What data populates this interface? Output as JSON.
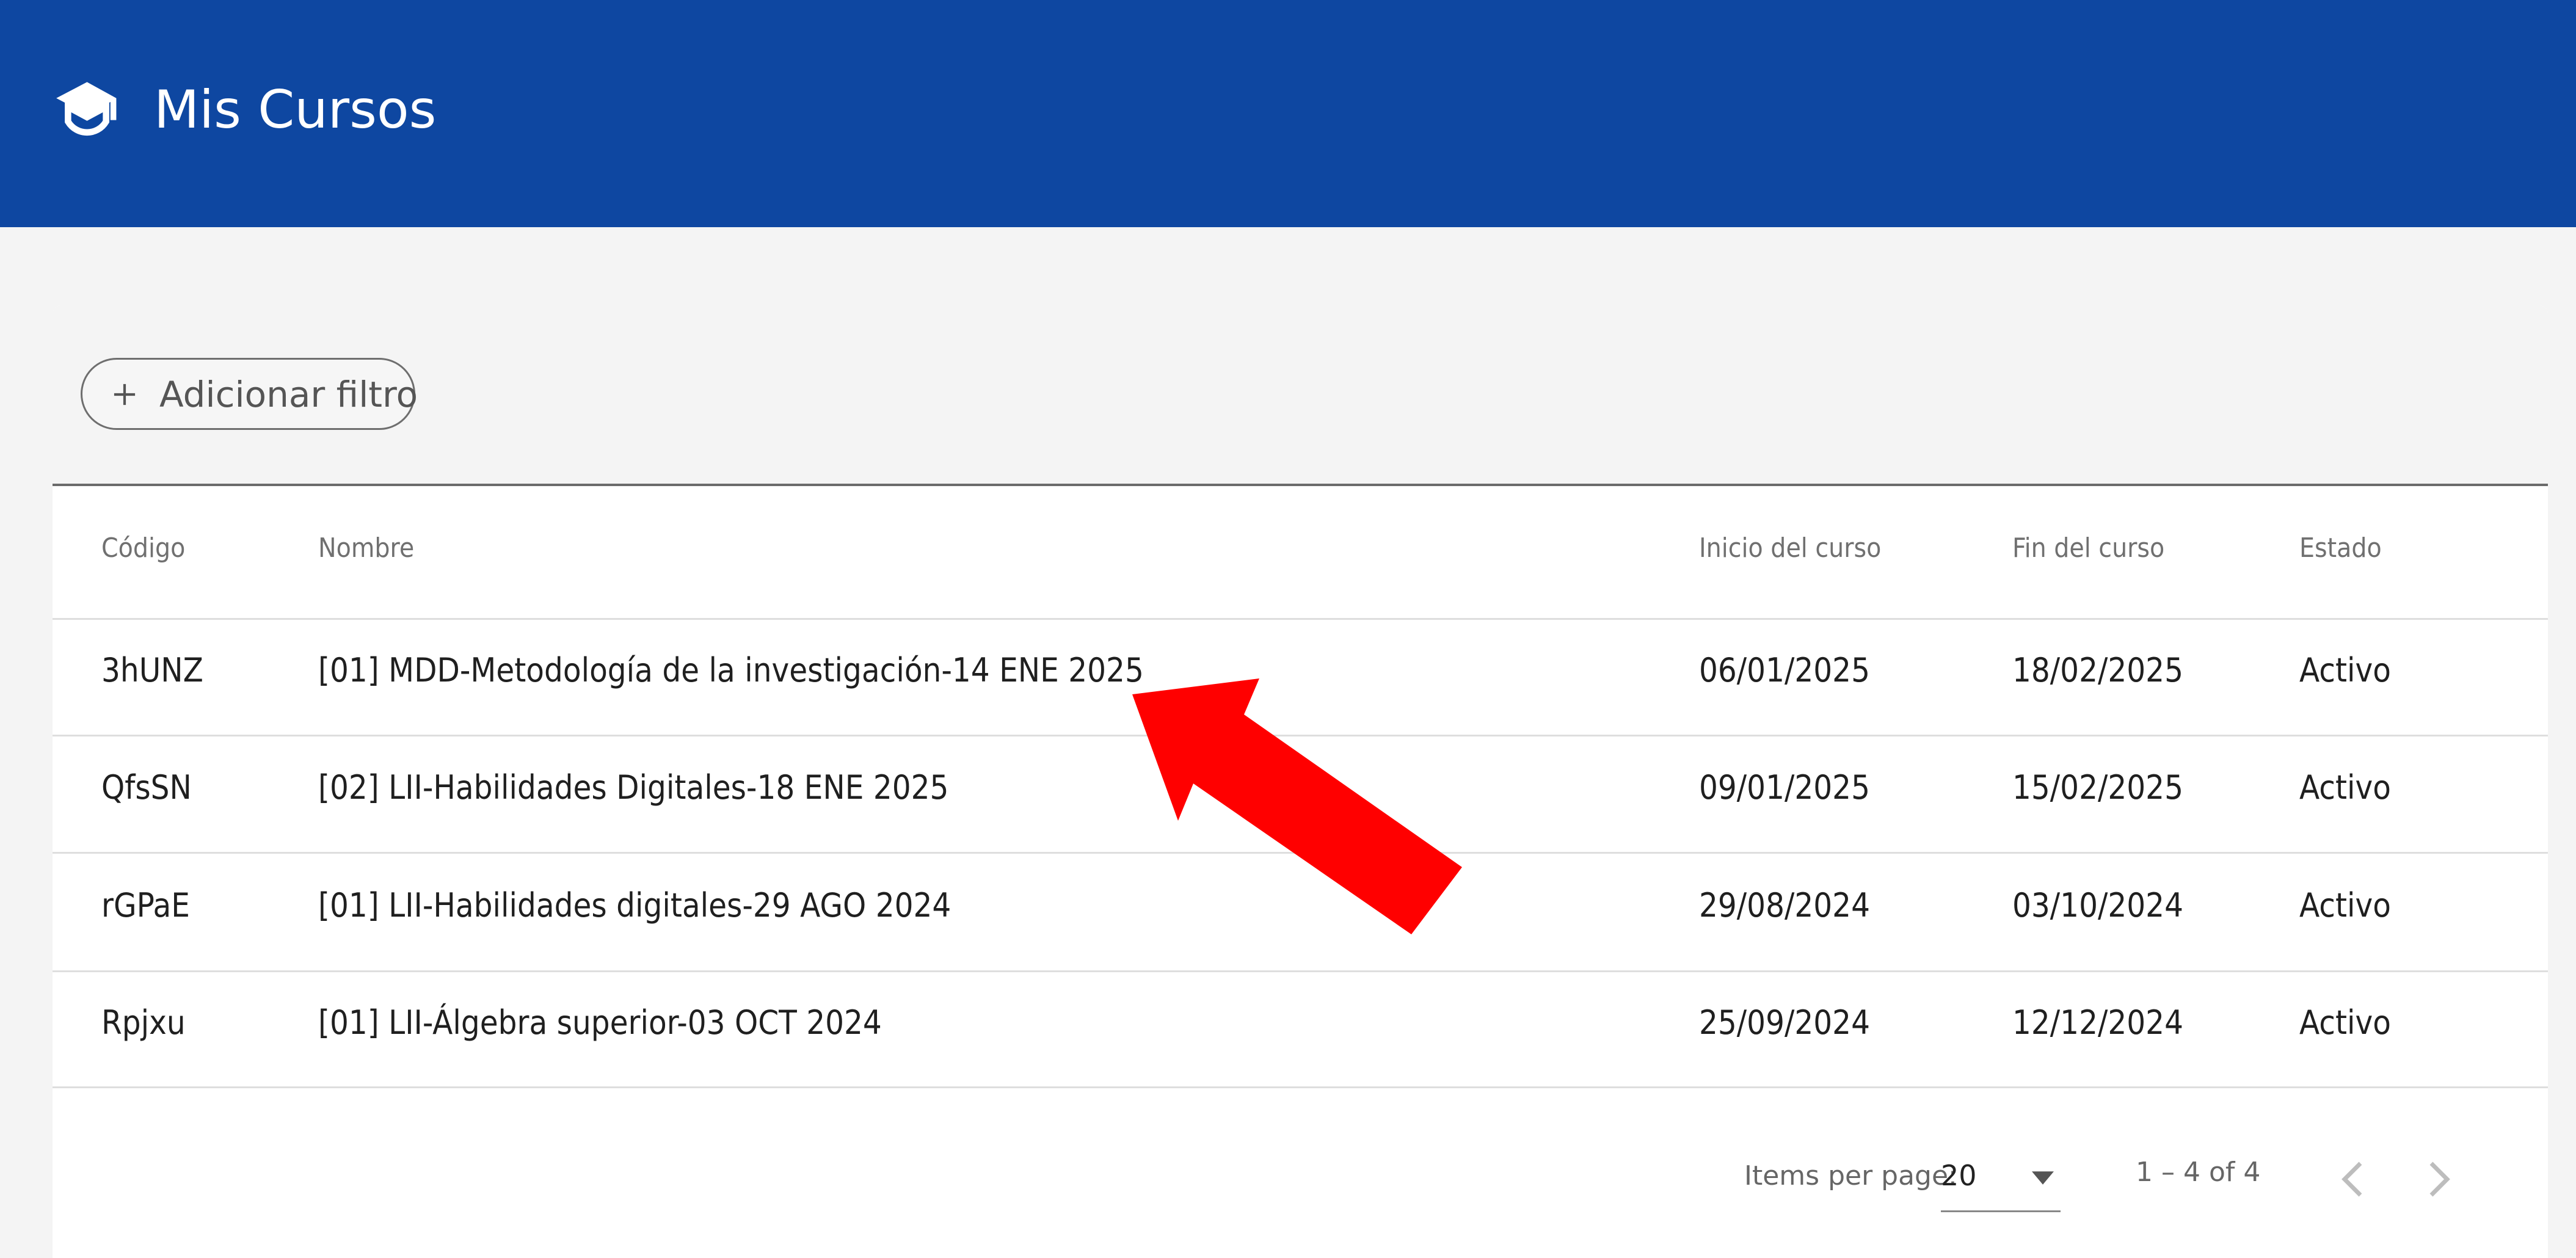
{
  "header": {
    "title": "Mis Cursos",
    "icon": "graduation-cap-icon",
    "background_color": "#0e47a1"
  },
  "filter": {
    "icon": "plus-icon",
    "label": "Adicionar filtro"
  },
  "table": {
    "headers": {
      "code": "Código",
      "name": "Nombre",
      "start": "Inicio del curso",
      "end": "Fin del curso",
      "status": "Estado"
    },
    "rows": [
      {
        "code": "3hUNZ",
        "name": "[01] MDD-Metodología de la investigación-14 ENE 2025",
        "start": "06/01/2025",
        "end": "18/02/2025",
        "status": "Activo"
      },
      {
        "code": "QfsSN",
        "name": "[02] LII-Habilidades Digitales-18 ENE 2025",
        "start": "09/01/2025",
        "end": "15/02/2025",
        "status": "Activo"
      },
      {
        "code": "rGPaE",
        "name": "[01] LII-Habilidades digitales-29 AGO 2024",
        "start": "29/08/2024",
        "end": "03/10/2024",
        "status": "Activo"
      },
      {
        "code": "Rpjxu",
        "name": "[01] LII-Álgebra superior-03 OCT 2024",
        "start": "25/09/2024",
        "end": "12/12/2024",
        "status": "Activo"
      }
    ]
  },
  "paginator": {
    "items_per_page_label": "Items per page:",
    "items_per_page_value": "20",
    "range_label": "1 – 4 of 4",
    "prev_icon": "chevron-left-icon",
    "next_icon": "chevron-right-icon"
  },
  "annotation": {
    "icon": "red-arrow-icon",
    "color": "#ff0000"
  }
}
